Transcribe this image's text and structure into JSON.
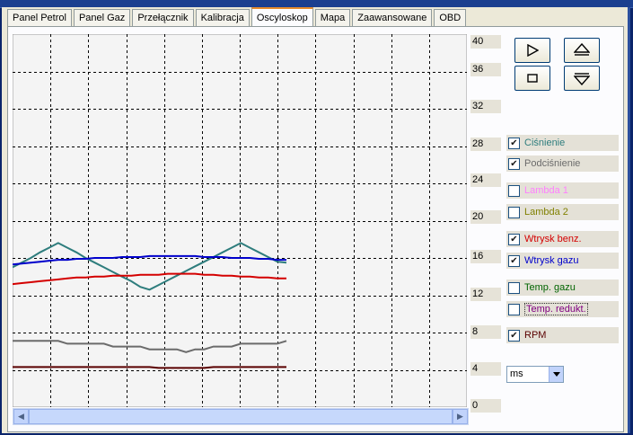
{
  "tabs": [
    {
      "label": "Panel Petrol",
      "active": false
    },
    {
      "label": "Panel Gaz",
      "active": false
    },
    {
      "label": "Przełącznik",
      "active": false
    },
    {
      "label": "Kalibracja",
      "active": false
    },
    {
      "label": "Oscyloskop",
      "active": true
    },
    {
      "label": "Mapa",
      "active": false
    },
    {
      "label": "Zaawansowane",
      "active": false
    },
    {
      "label": "OBD",
      "active": false
    }
  ],
  "y_axis_labels": [
    "40",
    "36",
    "32",
    "28",
    "24",
    "20",
    "16",
    "12",
    "8",
    "4",
    "0"
  ],
  "controls": {
    "play_icon": "play-icon",
    "stop_icon": "stop-icon",
    "zoom_in_icon": "scale-up-icon",
    "zoom_out_icon": "scale-down-icon"
  },
  "channels": [
    {
      "label": "Ciśnienie",
      "checked": true,
      "color": "#2e7d7d"
    },
    {
      "label": "Podciśnienie",
      "checked": true,
      "color": "#6b6b6b"
    },
    {
      "label": "Lambda 1",
      "checked": false,
      "color": "#ff80ff"
    },
    {
      "label": "Lambda 2",
      "checked": false,
      "color": "#808000"
    },
    {
      "label": "Wtrysk benz.",
      "checked": true,
      "color": "#d40000"
    },
    {
      "label": "Wtrysk gazu",
      "checked": true,
      "color": "#0000cc"
    },
    {
      "label": "Temp. gazu",
      "checked": false,
      "color": "#006400"
    },
    {
      "label": "Temp. redukt.",
      "checked": false,
      "color": "#800080"
    },
    {
      "label": "RPM",
      "checked": true,
      "color": "#5a0000"
    }
  ],
  "unit_select": {
    "value": "ms"
  },
  "chart_data": {
    "type": "line",
    "ylim": [
      0,
      40
    ],
    "grid": true,
    "x": [
      0,
      4,
      8,
      12,
      16,
      20,
      24,
      28,
      32,
      36,
      40,
      44,
      48,
      52,
      56,
      60,
      64,
      68,
      72,
      76,
      80,
      84,
      88,
      92,
      96,
      100,
      104,
      108,
      112,
      116,
      120
    ],
    "series": [
      {
        "name": "Ciśnienie",
        "color": "#2e7d7d",
        "values": [
          15,
          15.5,
          16,
          16.6,
          17.1,
          17.6,
          17.1,
          16.6,
          16,
          15.5,
          15,
          14.5,
          14,
          13.5,
          12.9,
          12.6,
          13.1,
          13.6,
          14.1,
          14.6,
          15.1,
          15.6,
          16.1,
          16.6,
          17.1,
          17.6,
          17.1,
          16.6,
          16.1,
          15.6,
          15.5
        ]
      },
      {
        "name": "Wtrysk gazu",
        "color": "#0000cc",
        "values": [
          15.3,
          15.4,
          15.5,
          15.6,
          15.7,
          15.8,
          15.8,
          15.9,
          15.9,
          16,
          16,
          16,
          16.1,
          16.1,
          16.1,
          16.2,
          16.2,
          16.2,
          16.2,
          16.2,
          16.2,
          16.1,
          16.1,
          16.1,
          16,
          16,
          16,
          15.9,
          15.9,
          15.8,
          15.8
        ]
      },
      {
        "name": "Wtrysk benz.",
        "color": "#d40000",
        "values": [
          13.2,
          13.3,
          13.4,
          13.5,
          13.6,
          13.7,
          13.8,
          13.9,
          13.9,
          14,
          14,
          14.1,
          14.1,
          14.1,
          14.2,
          14.2,
          14.2,
          14.3,
          14.3,
          14.3,
          14.3,
          14.2,
          14.2,
          14.1,
          14.1,
          14,
          14,
          13.9,
          13.9,
          13.8,
          13.8
        ]
      },
      {
        "name": "Podciśnienie",
        "color": "#6b6b6b",
        "values": [
          7.1,
          7.1,
          7.1,
          7.1,
          7.1,
          7.1,
          6.8,
          6.8,
          6.8,
          6.8,
          6.8,
          6.5,
          6.5,
          6.5,
          6.5,
          6.2,
          6.2,
          6.2,
          6.2,
          5.9,
          6.2,
          6.2,
          6.5,
          6.5,
          6.5,
          6.8,
          6.8,
          6.8,
          6.8,
          6.8,
          7.1
        ]
      },
      {
        "name": "RPM",
        "color": "#5a0000",
        "values": [
          4.3,
          4.3,
          4.3,
          4.3,
          4.3,
          4.3,
          4.3,
          4.3,
          4.3,
          4.3,
          4.3,
          4.3,
          4.3,
          4.3,
          4.3,
          4.3,
          4.2,
          4.2,
          4.2,
          4.2,
          4.2,
          4.2,
          4.3,
          4.3,
          4.3,
          4.3,
          4.3,
          4.3,
          4.3,
          4.3,
          4.3
        ]
      }
    ]
  }
}
